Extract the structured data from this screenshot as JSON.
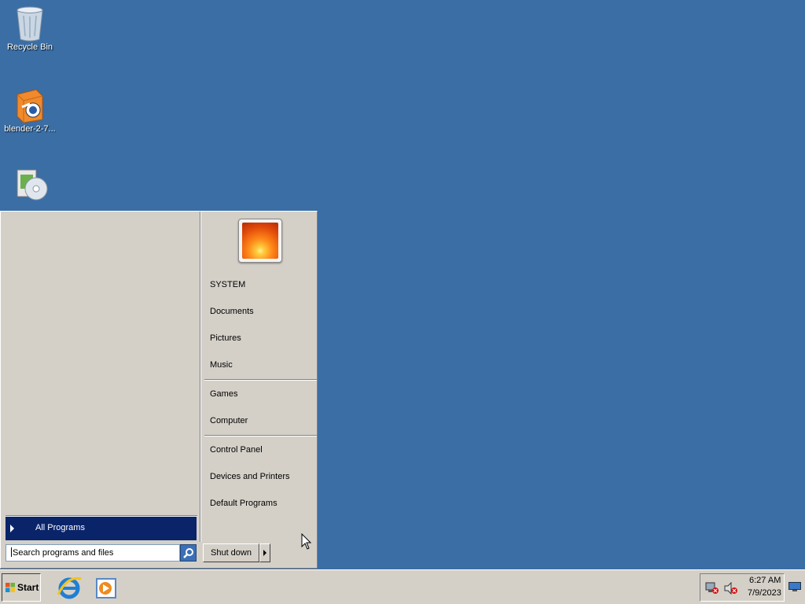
{
  "desktop": {
    "icons": [
      {
        "label": "Recycle Bin",
        "icon": "recycle-bin-icon"
      },
      {
        "label": "blender-2-7...",
        "icon": "blender-installer-icon"
      },
      {
        "label": "",
        "icon": "setup-disc-icon"
      }
    ],
    "background_color": "#3a6ea5"
  },
  "start_menu": {
    "all_programs_label": "All Programs",
    "search_placeholder": "Search programs and files",
    "shutdown_label": "Shut down",
    "user_picture": "user-picture-flower",
    "right_items": [
      {
        "label": "SYSTEM"
      },
      {
        "label": "Documents"
      },
      {
        "label": "Pictures"
      },
      {
        "label": "Music"
      },
      {
        "label": "Games"
      },
      {
        "label": "Computer"
      },
      {
        "label": "Control Panel"
      },
      {
        "label": "Devices and Printers"
      },
      {
        "label": "Default Programs"
      }
    ]
  },
  "taskbar": {
    "start_label": "Start",
    "pinned": [
      {
        "name": "internet-explorer-icon"
      },
      {
        "name": "media-player-icon"
      }
    ],
    "tray": {
      "icons": [
        "network-disconnected-icon",
        "volume-muted-icon"
      ],
      "time": "6:27 AM",
      "date": "7/9/2023"
    }
  }
}
